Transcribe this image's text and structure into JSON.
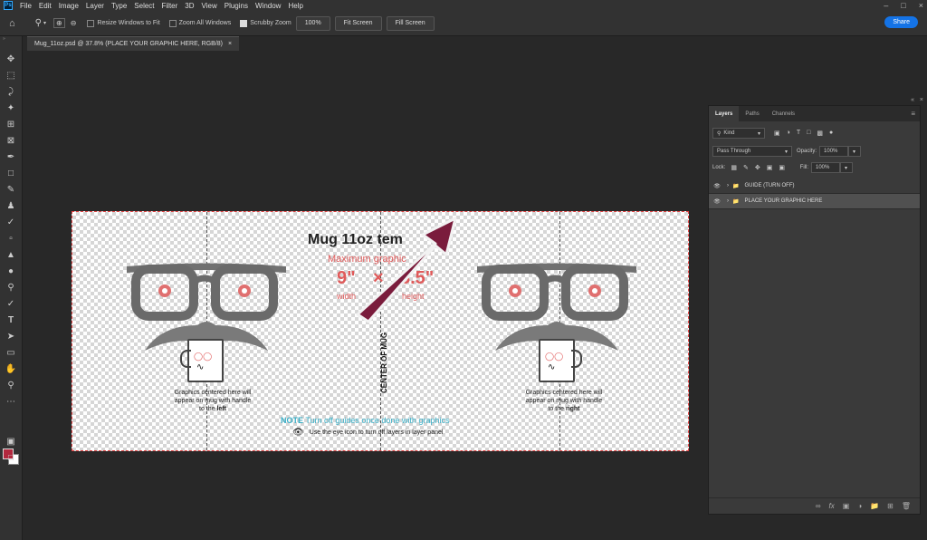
{
  "menu": {
    "logo": "Ps",
    "items": [
      "File",
      "Edit",
      "Image",
      "Layer",
      "Type",
      "Select",
      "Filter",
      "3D",
      "View",
      "Plugins",
      "Window",
      "Help"
    ]
  },
  "options": {
    "resize_label": "Resize Windows to Fit",
    "zoom_all_label": "Zoom All Windows",
    "scrubby_label": "Scrubby Zoom",
    "zoom_value": "100%",
    "fit_screen": "Fit Screen",
    "fill_screen": "Fill Screen",
    "share": "Share"
  },
  "document_tab": {
    "title": "Mug_11oz.psd @ 37.8% (PLACE YOUR GRAPHIC HERE, RGB/8)",
    "close": "×"
  },
  "canvas": {
    "title": "Mug 11oz tem",
    "max_graphic": "Maximum graphic",
    "dim_width": "9\"",
    "dim_x": "×",
    "dim_height": "3.5\"",
    "width_label": "width",
    "height_label": "height",
    "center_label": "CENTER OF MUG",
    "caption_left_1": "Graphics centered here will",
    "caption_left_2": "appear on mug with handle",
    "caption_left_3": "to the",
    "caption_left_bold": "left",
    "caption_right_1": "Graphics centered here will",
    "caption_right_2": "appear on mug with handle",
    "caption_right_3": "to the",
    "caption_right_bold": "right",
    "note_bold": "NOTE",
    "note_text": "Turn off guides once done with graphics",
    "eye_text": "Use the eye icon to turn off layers in layer panel"
  },
  "layers": {
    "tabs": [
      "Layers",
      "Paths",
      "Channels"
    ],
    "kind_label": "Kind",
    "blend_mode": "Pass Through",
    "opacity_label": "Opacity:",
    "opacity_value": "100%",
    "lock_label": "Lock:",
    "fill_label": "Fill:",
    "fill_value": "100%",
    "rows": [
      {
        "name": "GUIDE (TURN OFF)"
      },
      {
        "name": "PLACE YOUR GRAPHIC HERE"
      }
    ]
  },
  "colors": {
    "foreground": "#b2283e",
    "background": "#ffffff",
    "arrow": "#7a1c3c",
    "accent_red": "#e05a5a",
    "note_blue": "#3ab0c8"
  }
}
